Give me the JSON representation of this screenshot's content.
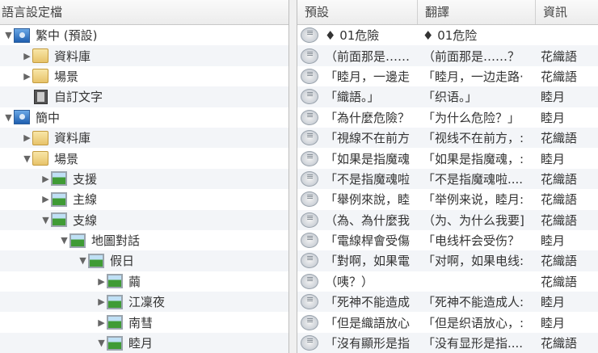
{
  "tree": {
    "header": "語言設定檔",
    "items": [
      {
        "label": "繁中 (預設)",
        "icon": "globe",
        "exp": "▼",
        "level": 0
      },
      {
        "label": "資料庫",
        "icon": "folder",
        "exp": "▶",
        "level": 1
      },
      {
        "label": "場景",
        "icon": "folder",
        "exp": "▶",
        "level": 1
      },
      {
        "label": "自訂文字",
        "icon": "book",
        "exp": "",
        "level": 1
      },
      {
        "label": "簡中",
        "icon": "globe",
        "exp": "▼",
        "level": 0
      },
      {
        "label": "資料庫",
        "icon": "folder",
        "exp": "▶",
        "level": 1
      },
      {
        "label": "場景",
        "icon": "folder",
        "exp": "▼",
        "level": 1
      },
      {
        "label": "支援",
        "icon": "scene",
        "exp": "▶",
        "level": 2
      },
      {
        "label": "主線",
        "icon": "scene",
        "exp": "▶",
        "level": 2
      },
      {
        "label": "支線",
        "icon": "scene",
        "exp": "▼",
        "level": 2
      },
      {
        "label": "地圖對話",
        "icon": "scene",
        "exp": "▼",
        "level": 3
      },
      {
        "label": "假日",
        "icon": "scene",
        "exp": "▼",
        "level": 4
      },
      {
        "label": "繭",
        "icon": "scene",
        "exp": "▶",
        "level": 5
      },
      {
        "label": "江凜夜",
        "icon": "scene",
        "exp": "▶",
        "level": 5
      },
      {
        "label": "南彗",
        "icon": "scene",
        "exp": "▶",
        "level": 5
      },
      {
        "label": "睦月",
        "icon": "scene",
        "exp": "▼",
        "level": 5
      }
    ]
  },
  "table": {
    "headers": [
      "預設",
      "翻譯",
      "資訊"
    ],
    "rows": [
      [
        "♦ 01危險",
        "♦ 01危险",
        ""
      ],
      [
        "（前面那是……",
        "（前面那是……？",
        "花織語"
      ],
      [
        "「睦月，一邊走",
        "「睦月，一边走路·",
        "花織語"
      ],
      [
        "「織語。」",
        "「织语。」",
        "睦月"
      ],
      [
        "「為什麼危險？",
        "「为什么危险？」",
        "睦月"
      ],
      [
        "「視線不在前方",
        "「视线不在前方，:",
        "花織語"
      ],
      [
        "「如果是指魔魂",
        "「如果是指魔魂，:",
        "睦月"
      ],
      [
        "「不是指魔魂啦",
        "「不是指魔魂啦....",
        "花織語"
      ],
      [
        "「舉例來說，睦",
        "「举例来说，睦月:",
        "花織語"
      ],
      [
        "（為、為什麼我",
        "（为、为什么我要]",
        "花織語"
      ],
      [
        "「電線桿會受傷",
        "「电线杆会受伤？",
        "睦月"
      ],
      [
        "「對啊，如果電",
        "「对啊，如果电线:",
        "花織語"
      ],
      [
        "（咦？）",
        "",
        "花織語"
      ],
      [
        "「死神不能造成",
        "「死神不能造成人:",
        "睦月"
      ],
      [
        "「但是織語放心",
        "「但是织语放心，:",
        "睦月"
      ],
      [
        "「沒有顯形是指",
        "「没有显形是指....",
        "花織語"
      ]
    ]
  }
}
